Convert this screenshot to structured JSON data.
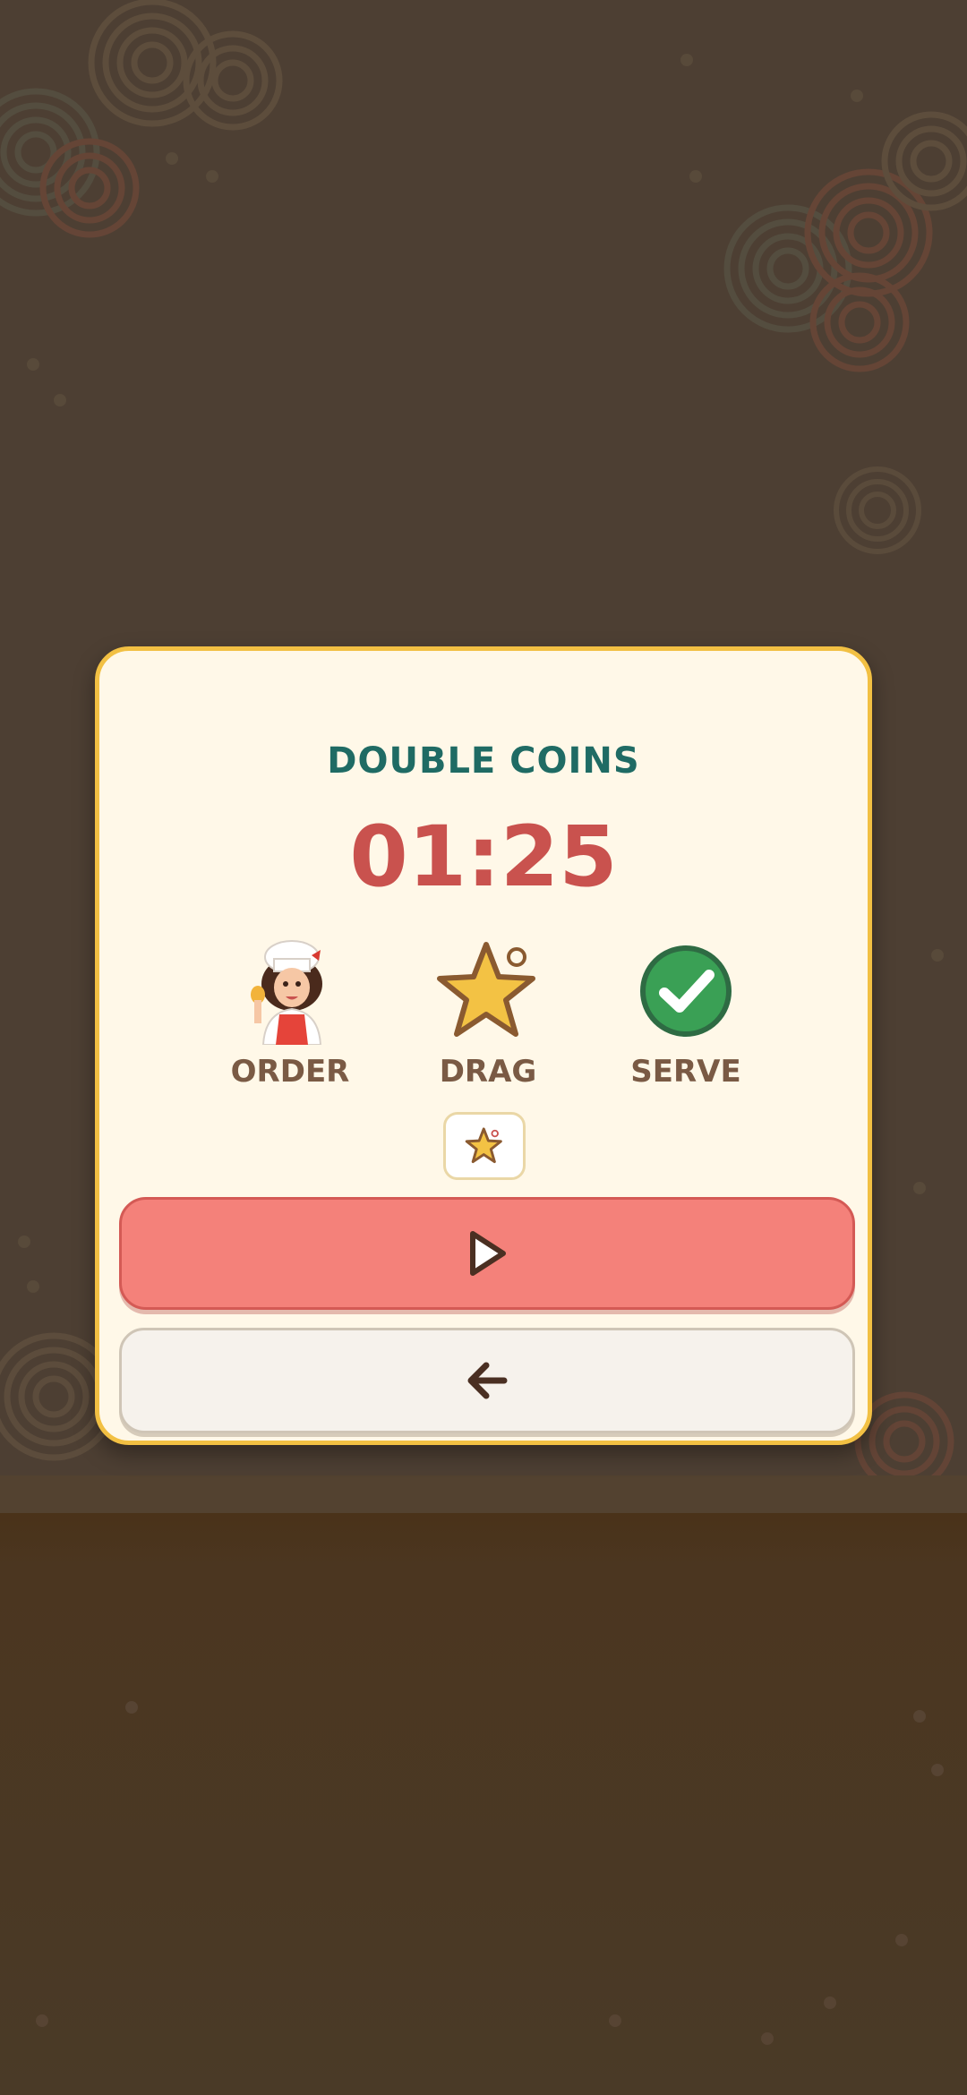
{
  "dialog": {
    "title": "DOUBLE COINS",
    "timer": "01:25",
    "steps": [
      {
        "icon": "chef-character-icon",
        "label": "ORDER"
      },
      {
        "icon": "star-icon",
        "label": "DRAG"
      },
      {
        "icon": "checkmark-icon",
        "label": "SERVE"
      }
    ],
    "badge_icon": "small-star-icon",
    "play_icon": "play-icon",
    "back_icon": "back-arrow-icon"
  },
  "colors": {
    "title": "#1f6b64",
    "timer": "#c9524e",
    "dialog_bg": "#fff8e8",
    "dialog_border": "#f2c043",
    "play_button": "#f4817a",
    "back_button": "#f6f2ec",
    "label": "#7a5a44"
  }
}
